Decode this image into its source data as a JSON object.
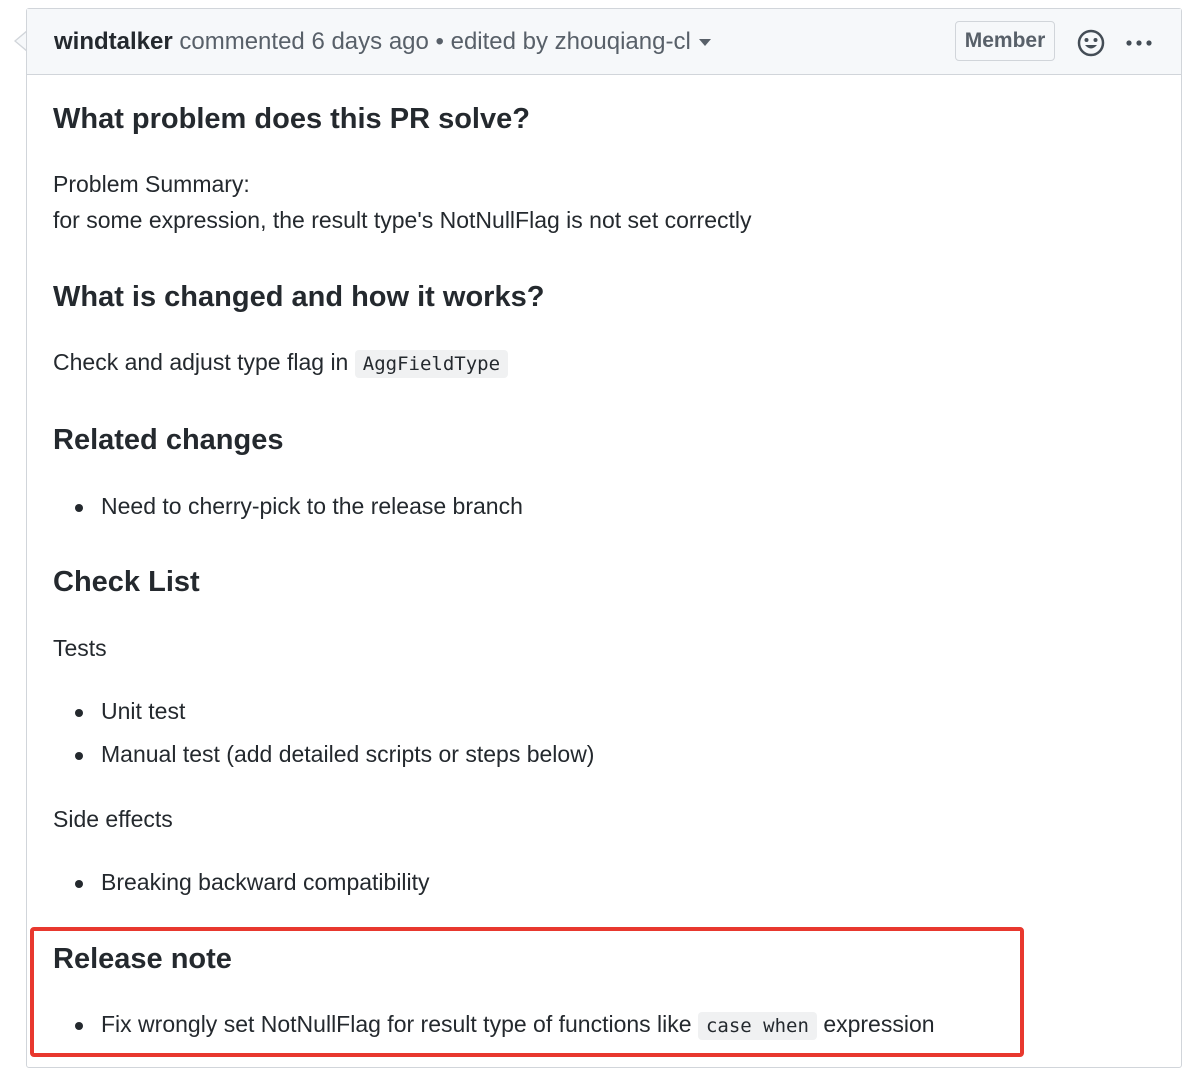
{
  "header": {
    "author": "windtalker",
    "action": "commented",
    "time": "6 days ago",
    "separator": "•",
    "edited": "edited by zhouqiang-cl",
    "badge": "Member",
    "emoji_icon": "smiley-icon",
    "more_icon": "kebab-horizontal-icon"
  },
  "sections": {
    "problem": {
      "heading": "What problem does this PR solve?",
      "lines": [
        "Problem Summary:",
        "for some expression, the result type's NotNullFlag is not set correctly"
      ]
    },
    "changes": {
      "heading": "What is changed and how it works?",
      "text": "Check and adjust type flag in",
      "code": "AggFieldType"
    },
    "related": {
      "heading": "Related changes",
      "items": [
        "Need to cherry-pick to the release branch"
      ]
    },
    "checklist": {
      "heading": "Check List",
      "tests_label": "Tests",
      "tests": [
        "Unit test",
        "Manual test (add detailed scripts or steps below)"
      ],
      "side_label": "Side effects",
      "side": [
        "Breaking backward compatibility"
      ]
    },
    "release": {
      "heading": "Release note",
      "text_before": "Fix wrongly set NotNullFlag for result type of functions like",
      "code": "case when",
      "text_after": "expression"
    }
  },
  "colors": {
    "highlight": "#e8382e",
    "header_bg": "#f6f8fa",
    "border": "#d1d5da"
  }
}
